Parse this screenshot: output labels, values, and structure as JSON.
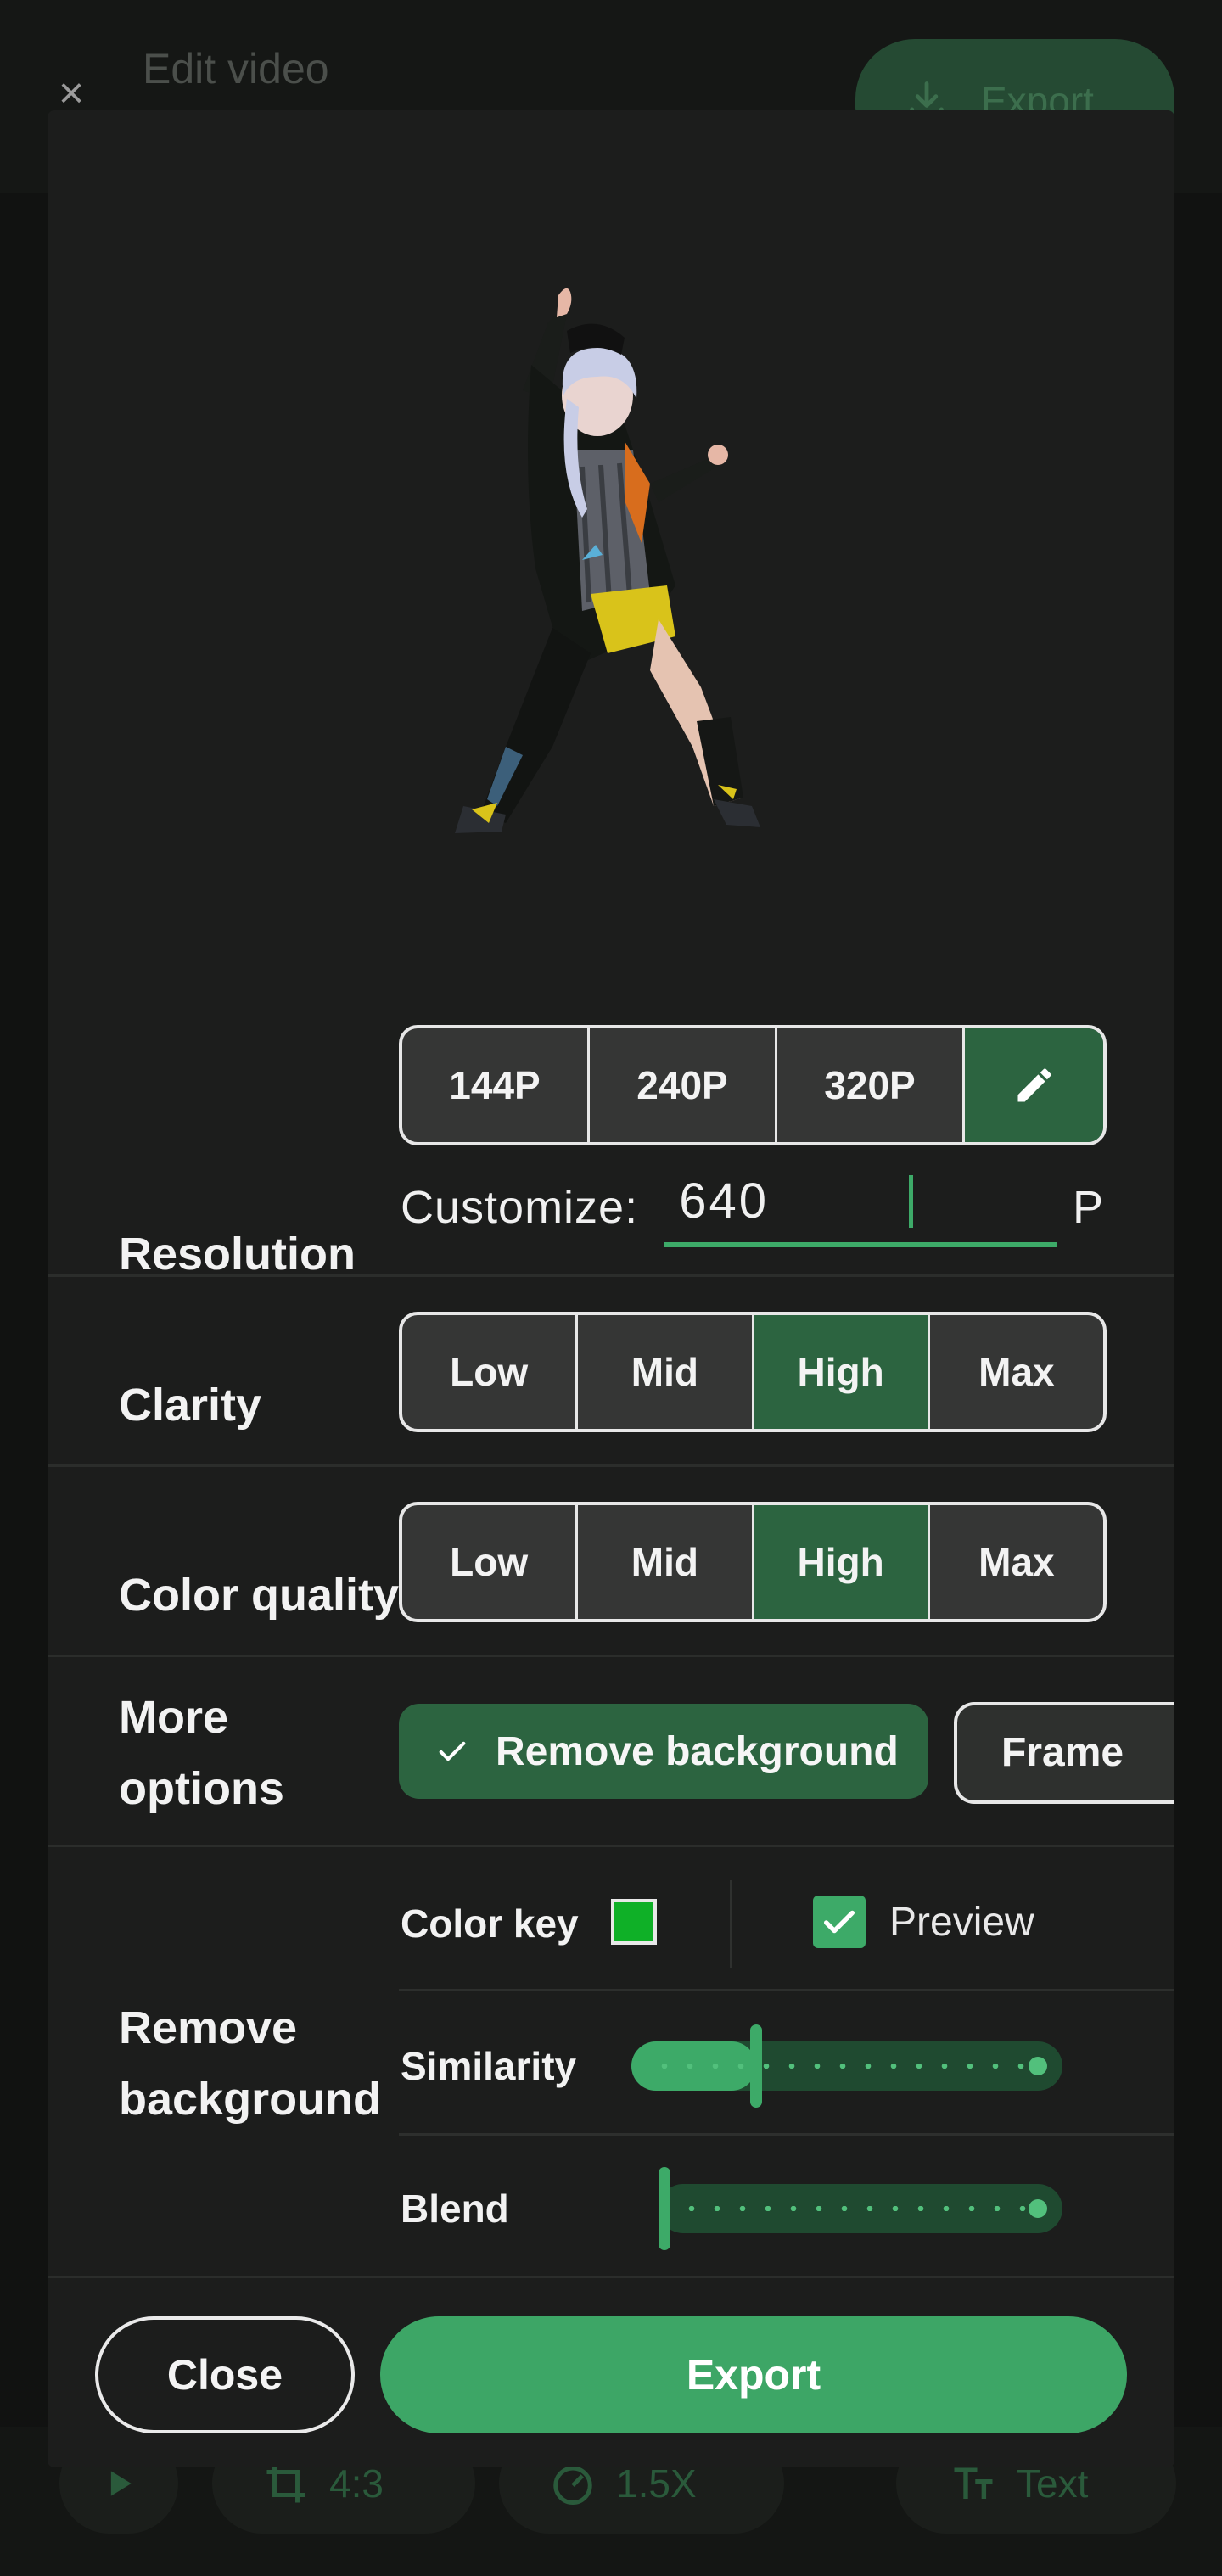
{
  "app": {
    "title": "Edit video",
    "export_label": "Export",
    "toolbar": {
      "aspect_label": "4:3",
      "speed_label": "1.5X",
      "text_label": "Text"
    }
  },
  "dialog": {
    "resolution": {
      "label": "Resolution",
      "options": [
        "144P",
        "240P",
        "320P"
      ],
      "selected": "custom",
      "customize_label": "Customize:",
      "customize_value": "640",
      "unit": "P"
    },
    "clarity": {
      "label": "Clarity",
      "options": [
        "Low",
        "Mid",
        "High",
        "Max"
      ],
      "selected": "High"
    },
    "color_quality": {
      "label": "Color quality",
      "options": [
        "Low",
        "Mid",
        "High",
        "Max"
      ],
      "selected": "High"
    },
    "more_options": {
      "label_line1": "More",
      "label_line2": "options",
      "chips": [
        {
          "label": "Remove background",
          "checked": true
        },
        {
          "label": "Frame",
          "checked": false
        }
      ]
    },
    "remove_background": {
      "label_line1": "Remove",
      "label_line2": "background",
      "color_key_label": "Color key",
      "color_key": "#0fb027",
      "preview_label": "Preview",
      "preview_checked": true,
      "similarity_label": "Similarity",
      "similarity_fraction": 0.29,
      "blend_label": "Blend",
      "blend_fraction": 0.0
    },
    "close_label": "Close",
    "export_label": "Export"
  },
  "colors": {
    "accent": "#3da666",
    "accent_dark": "#2c6440",
    "surface": "#1c1d1c"
  }
}
